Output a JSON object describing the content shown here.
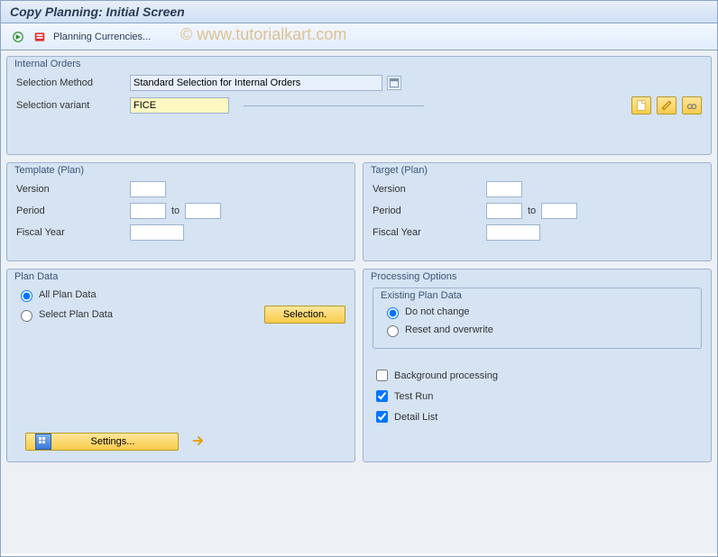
{
  "title": "Copy Planning: Initial Screen",
  "watermark": "©   www.tutorialkart.com",
  "toolbar": {
    "execute_hint": "Execute",
    "planning_currencies_label": "Planning Currencies..."
  },
  "groups": {
    "internal_orders": {
      "title": "Internal Orders",
      "selection_method_label": "Selection Method",
      "selection_method_value": "Standard Selection for Internal Orders",
      "selection_variant_label": "Selection variant",
      "selection_variant_value": "FICE"
    },
    "template_plan": {
      "title": "Template (Plan)",
      "version_label": "Version",
      "period_label": "Period",
      "to_label": "to",
      "fiscal_year_label": "Fiscal Year"
    },
    "target_plan": {
      "title": "Target (Plan)",
      "version_label": "Version",
      "period_label": "Period",
      "to_label": "to",
      "fiscal_year_label": "Fiscal Year"
    },
    "plan_data": {
      "title": "Plan Data",
      "all_plan_data_label": "All Plan Data",
      "select_plan_data_label": "Select Plan Data",
      "selection_button": "Selection.",
      "settings_button": "Settings..."
    },
    "processing_options": {
      "title": "Processing Options",
      "existing_plan_data_title": "Existing Plan Data",
      "do_not_change_label": "Do not change",
      "reset_overwrite_label": "Reset and overwrite",
      "background_label": "Background processing",
      "test_run_label": "Test Run",
      "detail_list_label": "Detail List"
    }
  }
}
